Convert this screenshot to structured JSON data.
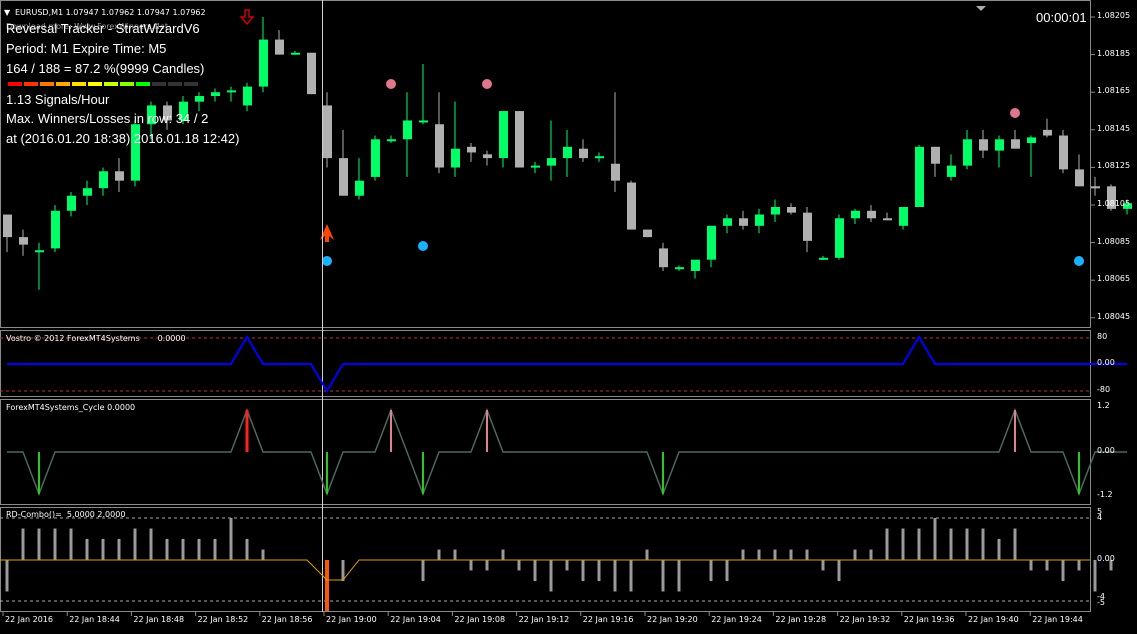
{
  "window": {
    "symbol_title": "EURUSD,M1  1.07947 1.07962 1.07947 1.07962",
    "timer": "00:00:01",
    "overlay_note": "Download more: Www.ForexWinners.Net"
  },
  "info_panel": {
    "line1": "Reversal Tracker - StratWizardV6",
    "line2": "Period: M1 Expire Time: M5",
    "line3": "164 / 188 = 87.2 %(9999 Candles)",
    "line4": "1.13 Signals/Hour",
    "line5": "Max. Winners/Losses in row: 34 / 2",
    "line6": "at  (2016.01.20 18:38) 2016.01.18 12:42)"
  },
  "colors": {
    "bull": "#00ff66",
    "bear": "#b0b0b0",
    "buy_arrow": "#ff4500",
    "sell_arrow": "#cc0000",
    "dot_buy": "#1ab2ff",
    "dot_sell": "#e0768c",
    "vostro_line": "#0000ff",
    "cycle_line": "#4a6a5a",
    "rd_line": "#e0a000",
    "swatches": [
      "#ff0000",
      "#ff3300",
      "#ff7700",
      "#ffaa00",
      "#ffdd00",
      "#ffff00",
      "#ccff00",
      "#88ff00",
      "#00ff00",
      "#333333",
      "#333333",
      "#333333"
    ]
  },
  "price_axis": {
    "ticks": [
      "1.08205",
      "1.08185",
      "1.08165",
      "1.08145",
      "1.08125",
      "1.08105",
      "1.08085",
      "1.08065",
      "1.08045"
    ]
  },
  "panels": {
    "vostro": {
      "label": "Vostro © 2012 ForexMT4Systems",
      "value": "0.0000",
      "ticks": [
        "80",
        "0.00",
        "-80"
      ]
    },
    "cycle": {
      "label": "ForexMT4Systems_Cycle",
      "value": "0.0000",
      "ticks": [
        "1.2",
        "0.00",
        "-1.2"
      ]
    },
    "rd_combo": {
      "label": "RD-Combo()=",
      "value": "5.0000 2.0000",
      "ticks": [
        "5",
        "4",
        "0.00",
        "-4",
        "-5"
      ]
    }
  },
  "time_axis": {
    "labels": [
      "22 Jan 2016",
      "22 Jan 18:44",
      "22 Jan 18:48",
      "22 Jan 18:52",
      "22 Jan 18:56",
      "22 Jan 19:00",
      "22 Jan 19:04",
      "22 Jan 19:08",
      "22 Jan 19:12",
      "22 Jan 19:16",
      "22 Jan 19:20",
      "22 Jan 19:24",
      "22 Jan 19:28",
      "22 Jan 19:32",
      "22 Jan 19:36",
      "22 Jan 19:40",
      "22 Jan 19:44"
    ]
  },
  "candles": [
    [
      1.081,
      1.081,
      1.0808,
      1.08088
    ],
    [
      1.08088,
      1.08092,
      1.08078,
      1.08084
    ],
    [
      1.0808,
      1.08085,
      1.0806,
      1.08081
    ],
    [
      1.08082,
      1.08105,
      1.0808,
      1.08102
    ],
    [
      1.08102,
      1.08112,
      1.08099,
      1.0811
    ],
    [
      1.0811,
      1.08118,
      1.08105,
      1.08114
    ],
    [
      1.08114,
      1.08125,
      1.0811,
      1.08123
    ],
    [
      1.08123,
      1.0813,
      1.08112,
      1.08118
    ],
    [
      1.08118,
      1.0815,
      1.08115,
      1.08148
    ],
    [
      1.08148,
      1.0816,
      1.0814,
      1.08158
    ],
    [
      1.08158,
      1.0816,
      1.08145,
      1.0815
    ],
    [
      1.0815,
      1.08163,
      1.08148,
      1.0816
    ],
    [
      1.0816,
      1.08165,
      1.08155,
      1.08163
    ],
    [
      1.08163,
      1.08167,
      1.0816,
      1.08165
    ],
    [
      1.08165,
      1.08168,
      1.0816,
      1.08166
    ],
    [
      1.08158,
      1.0817,
      1.08155,
      1.08168
    ],
    [
      1.08168,
      1.08205,
      1.08165,
      1.08193
    ],
    [
      1.08193,
      1.08198,
      1.08185,
      1.08185
    ],
    [
      1.08185,
      1.08187,
      1.08185,
      1.08186
    ],
    [
      1.08186,
      1.08186,
      1.08164,
      1.08164
    ],
    [
      1.08158,
      1.08165,
      1.08125,
      1.0813
    ],
    [
      1.0813,
      1.08145,
      1.0811,
      1.0811
    ],
    [
      1.0811,
      1.0813,
      1.08108,
      1.08118
    ],
    [
      1.0812,
      1.08142,
      1.08118,
      1.0814
    ],
    [
      1.0814,
      1.08142,
      1.08138,
      1.0814
    ],
    [
      1.0814,
      1.08165,
      1.0812,
      1.0815
    ],
    [
      1.0815,
      1.0818,
      1.08148,
      1.0815
    ],
    [
      1.08148,
      1.08165,
      1.08122,
      1.08125
    ],
    [
      1.08125,
      1.0816,
      1.0812,
      1.08135
    ],
    [
      1.08136,
      1.08138,
      1.08128,
      1.08133
    ],
    [
      1.08132,
      1.08134,
      1.08126,
      1.0813
    ],
    [
      1.0813,
      1.08142,
      1.08125,
      1.08155
    ],
    [
      1.08155,
      1.08155,
      1.08125,
      1.08125
    ],
    [
      1.08125,
      1.08128,
      1.08122,
      1.08126
    ],
    [
      1.08126,
      1.0815,
      1.08118,
      1.0813
    ],
    [
      1.0813,
      1.08145,
      1.0812,
      1.08136
    ],
    [
      1.08135,
      1.0814,
      1.08128,
      1.0813
    ],
    [
      1.0813,
      1.08133,
      1.08128,
      1.08131
    ],
    [
      1.08127,
      1.08165,
      1.08112,
      1.08118
    ],
    [
      1.08117,
      1.08118,
      1.08092,
      1.08092
    ],
    [
      1.08092,
      1.08092,
      1.08088,
      1.08088
    ],
    [
      1.08082,
      1.08085,
      1.0807,
      1.08072
    ],
    [
      1.08072,
      1.08073,
      1.0807,
      1.08072
    ],
    [
      1.0807,
      1.08075,
      1.08066,
      1.08076
    ],
    [
      1.08076,
      1.08094,
      1.08072,
      1.08094
    ],
    [
      1.08094,
      1.081,
      1.0809,
      1.08098
    ],
    [
      1.08098,
      1.08102,
      1.08092,
      1.08094
    ],
    [
      1.08094,
      1.08103,
      1.0809,
      1.081
    ],
    [
      1.081,
      1.08108,
      1.08096,
      1.08104
    ],
    [
      1.08104,
      1.08106,
      1.081,
      1.08101
    ],
    [
      1.08101,
      1.08104,
      1.0808,
      1.08086
    ],
    [
      1.08076,
      1.08078,
      1.08076,
      1.08077
    ],
    [
      1.08077,
      1.081,
      1.08076,
      1.08098
    ],
    [
      1.08098,
      1.08103,
      1.08095,
      1.08102
    ],
    [
      1.08102,
      1.08105,
      1.08096,
      1.08098
    ],
    [
      1.08098,
      1.08101,
      1.08097,
      1.08097
    ],
    [
      1.08094,
      1.08104,
      1.08092,
      1.08104
    ],
    [
      1.08104,
      1.08137,
      1.08104,
      1.08136
    ],
    [
      1.08136,
      1.08136,
      1.0812,
      1.08127
    ],
    [
      1.0812,
      1.08132,
      1.08118,
      1.08126
    ],
    [
      1.08126,
      1.08145,
      1.08124,
      1.0814
    ],
    [
      1.0814,
      1.08145,
      1.0813,
      1.08134
    ],
    [
      1.08134,
      1.08142,
      1.08125,
      1.0814
    ],
    [
      1.0814,
      1.08145,
      1.08136,
      1.08135
    ],
    [
      1.08138,
      1.08142,
      1.0812,
      1.08141
    ],
    [
      1.08145,
      1.08151,
      1.08141,
      1.08142
    ],
    [
      1.08142,
      1.08145,
      1.08122,
      1.08124
    ],
    [
      1.08124,
      1.08132,
      1.08115,
      1.08115
    ],
    [
      1.08115,
      1.0812,
      1.0811,
      1.08114
    ],
    [
      1.08115,
      1.08116,
      1.08102,
      1.08103
    ],
    [
      1.08103,
      1.08108,
      1.081,
      1.08106
    ]
  ],
  "vostro_series": [
    0,
    0,
    0,
    0,
    0,
    0,
    0,
    0,
    0,
    0,
    0,
    0,
    0,
    0,
    0,
    0,
    0,
    0,
    0,
    0,
    0,
    -1,
    0,
    0,
    0,
    0,
    0,
    0,
    0,
    0,
    0,
    0,
    0,
    0,
    0,
    0,
    0,
    0,
    0,
    0,
    0,
    0,
    0,
    0,
    0,
    0,
    0,
    0,
    0,
    0,
    0,
    0,
    0,
    0,
    0,
    0,
    0,
    0,
    0,
    0,
    0,
    0,
    0,
    0,
    0,
    0,
    0,
    0,
    0,
    0,
    0
  ],
  "signals": {
    "buy_arrows": [
      20
    ],
    "sell_arrows": [
      15
    ],
    "dots_buy": [
      20,
      26,
      67
    ],
    "dots_sell": [
      24,
      30,
      63
    ],
    "vostro_peaks": [
      15,
      57
    ],
    "vostro_troughs": [
      20
    ],
    "cycle_up": [
      15,
      24,
      30,
      63
    ],
    "cycle_down": [
      2,
      20,
      26,
      41,
      67
    ]
  },
  "rd_combo_bars": [
    -3,
    3,
    3,
    3,
    3,
    2,
    2,
    2,
    3,
    3,
    2,
    2,
    2,
    2,
    4,
    2,
    1,
    0,
    0,
    0,
    -4,
    -2,
    0,
    0,
    0,
    0,
    -2,
    1,
    1,
    -1,
    -1,
    1,
    -1,
    -2,
    -3,
    -1,
    -2,
    -2,
    -3,
    -3,
    1,
    -3,
    -3,
    0,
    -2,
    -2,
    1,
    1,
    1,
    1,
    1,
    -1,
    -2,
    1,
    1,
    3,
    3,
    3,
    4,
    3,
    3,
    3,
    2,
    3,
    -1,
    -1,
    -2,
    -1,
    -3,
    -1
  ]
}
